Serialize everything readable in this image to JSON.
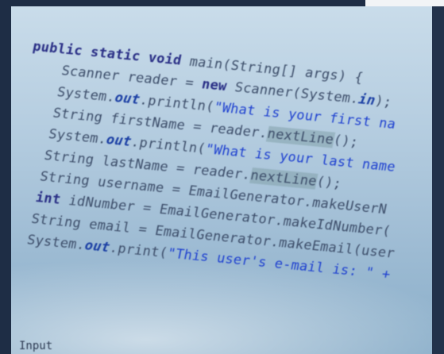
{
  "code": {
    "line1": {
      "kw": "public static void ",
      "rest": "main(String[] args) {"
    },
    "line2": {
      "pre": "    Scanner reader = ",
      "kw": "new",
      "rest": " Scanner(System.",
      "fld": "in",
      "end": ");"
    },
    "line3": {
      "pre": "    System.",
      "fld": "out",
      "mid": ".println(",
      "str": "\"What is your first na"
    },
    "line4": {
      "pre": "    String firstName = reader.",
      "hl": "nextLine",
      "end": "();"
    },
    "line5": {
      "pre": "    System.",
      "fld": "out",
      "mid": ".println(",
      "str": "\"What is your last name"
    },
    "line6": {
      "pre": "    String lastName = reader.",
      "hl": "nextLine",
      "end": "();"
    },
    "line7": {
      "text": "    String username = EmailGenerator.makeUserN"
    },
    "line8": {
      "kw": "    int",
      "rest": " idNumber = EmailGenerator.makeIdNumber("
    },
    "line9": {
      "text": "    String email = EmailGenerator.makeEmail(user"
    },
    "line10": {
      "pre": "    System.",
      "fld": "out",
      "mid": ".print(",
      "str": "\"This user's e-mail is: \" +"
    }
  },
  "bottom": {
    "text": "Input"
  }
}
